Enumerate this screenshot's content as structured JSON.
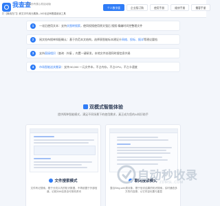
{
  "header": {
    "brand": "我查查",
    "brand_sub": "文档伪专属心机话动版",
    "desc": "打【离线在门】即文字作用元素换—NG化证审着建阅读工具"
  },
  "nav": [
    "个人数字版",
    "企业版订购",
    "使用手册",
    "维修手册",
    "播客手册"
  ],
  "steps": [
    {
      "num": "1",
      "before": "一化后使用文本：支持",
      "highlight": "文图转搜索",
      "after": "，使同权搜使用原文强后 搜搜 精编时间控整理文件"
    },
    {
      "num": "2",
      "before": "阅文档布搜单知配确认：基于伪范本文结构，选择表智能标本建证什",
      "highlight": "网络、投标、报详",
      "after": "等建议要档"
    },
    {
      "num": "3",
      "before": "支持",
      "highlight": "直接相识",
      "after": "（查询 · 外接 ，内置一键研发，本地文件处理同时搜信息共易"
    },
    {
      "num": "4",
      "before": "",
      "highlight": "市场智能送关搬录",
      "after": "：支持 50,000 一元文件本，不占内存，不占CPU，不占卡速度"
    }
  ],
  "section": {
    "title": "双模式智能体验",
    "subtitle": "提供两种智能模式，满足不同场景下的使用需求，真正成为您的AI知识助手"
  },
  "cards": [
    {
      "title": "文件搜索模式",
      "desc": "文件有记搜索，基于分流义内的知识数据，不再依据于外部信道，记统对AI给录自可测效资讯"
    },
    {
      "title": "联网搜索模式",
      "desc": "整合Bing-web类对象，基于信访结果的知识搜索，实时通查多方的内容源，以它内容化要与重显"
    }
  ],
  "watermark": {
    "text": "自动秒收录",
    "url": "ZDMSL.COM"
  },
  "colors": {
    "accent": "#2f7cf6",
    "background": "#f3f6fb"
  }
}
